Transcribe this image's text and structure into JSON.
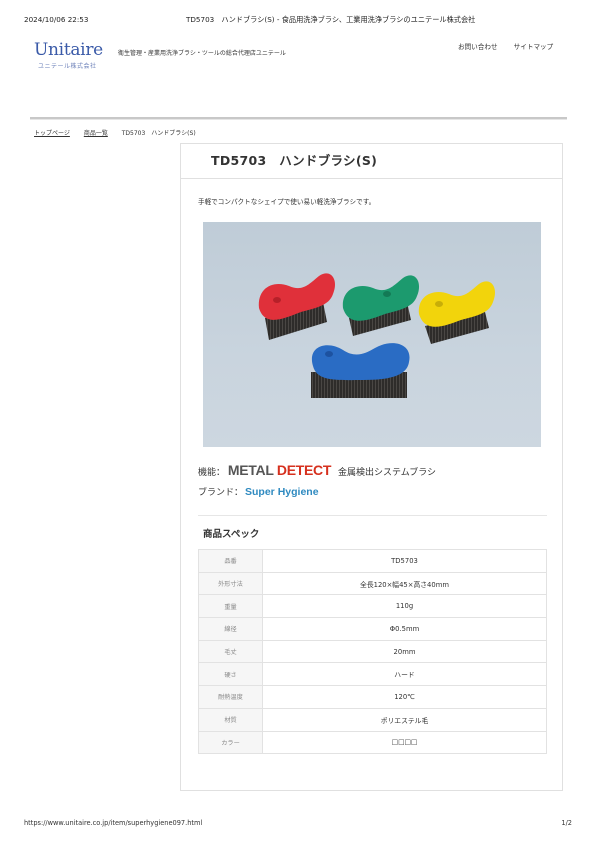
{
  "print_header": {
    "datetime": "2024/10/06 22:53",
    "title": "TD5703　ハンドブラシ(S) - 食品用洗浄ブラシ、工業用洗浄ブラシのユニテール株式会社"
  },
  "site": {
    "logo_text": "Unitaire",
    "logo_sub": "ユニテール株式会社",
    "tagline": "衛生管理・産業用洗浄ブラシ・ツールの総合代理店ユニテール",
    "nav": [
      "お問い合わせ",
      "サイトマップ"
    ],
    "colors": {
      "logo": "#3a5aa8",
      "metal_detect_red": "#d6301e",
      "brand_blue": "#2f8ac0"
    }
  },
  "breadcrumb": [
    "トップページ",
    "商品一覧",
    "TD5703　ハンドブラシ(S)"
  ],
  "product": {
    "title": "TD5703　ハンドブラシ(S)",
    "description": "手軽でコンパクトなシェイプで使い易い軽洗浄ブラシです。",
    "feature_label": "機能：",
    "feature_logo_metal": "METAL",
    "feature_logo_detect": "DETECT",
    "feature_desc": "金属検出システムブラシ",
    "brand_label": "ブランド：",
    "brand_value": "Super Hygiene",
    "photo_brush_colors": [
      "#e0303a",
      "#1c9a6e",
      "#f2d40c",
      "#2a6cc4"
    ]
  },
  "spec": {
    "heading": "商品スペック",
    "rows": [
      {
        "key": "品番",
        "value": "TD5703"
      },
      {
        "key": "外形寸法",
        "value": "全長120×幅45×高さ40mm"
      },
      {
        "key": "重量",
        "value": "110g"
      },
      {
        "key": "線径",
        "value": "Φ0.5mm"
      },
      {
        "key": "毛丈",
        "value": "20mm"
      },
      {
        "key": "硬さ",
        "value": "ハード"
      },
      {
        "key": "耐熱温度",
        "value": "120℃"
      },
      {
        "key": "材質",
        "value": "ポリエステル毛"
      },
      {
        "key": "カラー",
        "value": "□□□□"
      }
    ]
  },
  "print_footer": {
    "url": "https://www.unitaire.co.jp/item/superhygiene097.html",
    "page": "1/2"
  }
}
